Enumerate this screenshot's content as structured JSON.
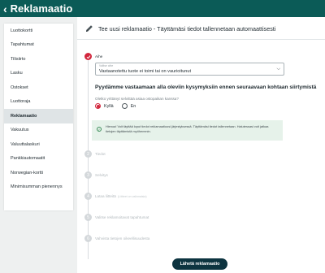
{
  "header": {
    "back_icon": "chevron-left-icon",
    "title": "Reklamaatio"
  },
  "sidebar": {
    "items": [
      {
        "label": "Luottokortti",
        "active": false
      },
      {
        "label": "Tapahtumat",
        "active": false
      },
      {
        "label": "Tilisiirto",
        "active": false
      },
      {
        "label": "Lasku",
        "active": false
      },
      {
        "label": "Ostokset",
        "active": false
      },
      {
        "label": "Luottoraja",
        "active": false
      },
      {
        "label": "Reklamaatio",
        "active": true
      },
      {
        "label": "Vakuutus",
        "active": false
      },
      {
        "label": "Valuuttalaskuri",
        "active": false
      },
      {
        "label": "Pankkiautomaatit",
        "active": false
      },
      {
        "label": "Norwegian-kortti",
        "active": false
      },
      {
        "label": "Minimisumman pienennys",
        "active": false
      }
    ]
  },
  "main": {
    "title": "Tee uusi reklamaatio - Täyttämäsi tiedot tallennetaan automaattisesti",
    "title_icon": "pencil-icon",
    "steps": [
      {
        "label": "Aihe",
        "state": "done",
        "number": "",
        "sub": ""
      },
      {
        "label": "Tiedot",
        "state": "pending",
        "number": "2",
        "sub": ""
      },
      {
        "label": "Selvitys",
        "state": "pending",
        "number": "3",
        "sub": ""
      },
      {
        "label": "Lataa liitteitä",
        "state": "pending",
        "number": "4",
        "sub": "(Liitteet on valinnaisia)"
      },
      {
        "label": "Valitse reklamoitavat tapahtumat",
        "state": "pending",
        "number": "5",
        "sub": ""
      },
      {
        "label": "Vahvista tietojen oikeellisuudesta",
        "state": "pending",
        "number": "6",
        "sub": ""
      }
    ],
    "select": {
      "label": "Valitse aihe",
      "value": "Vastaanotettu tuote ei toimi tai on vaurioitunut"
    },
    "question_heading": "Pyydämme vastaamaan alla oleviin kysymyksiin ennen seuraavaan kohtaan siirtymistä",
    "question": "Oletko yrittänyt selvittää asiaa ostopaikan kanssa?",
    "radio_options": [
      {
        "label": "Kyllä",
        "checked": true
      },
      {
        "label": "En",
        "checked": false
      }
    ],
    "notice": {
      "icon": "check-circle-icon",
      "text": "Hienoa! Voit täyttää loput tiedot reklamaatioosi järjestyksessä. Täyttämäsi tiedot tallennetaan. Halutessasi voit jatkaa tietojen täyttämistä myöhemmin."
    },
    "submit_label": "Lähetä reklamaatio"
  },
  "colors": {
    "header": "#0b5b57",
    "accent": "#d2273d",
    "notice_bg": "#e6f2ea",
    "button": "#0d3440"
  }
}
